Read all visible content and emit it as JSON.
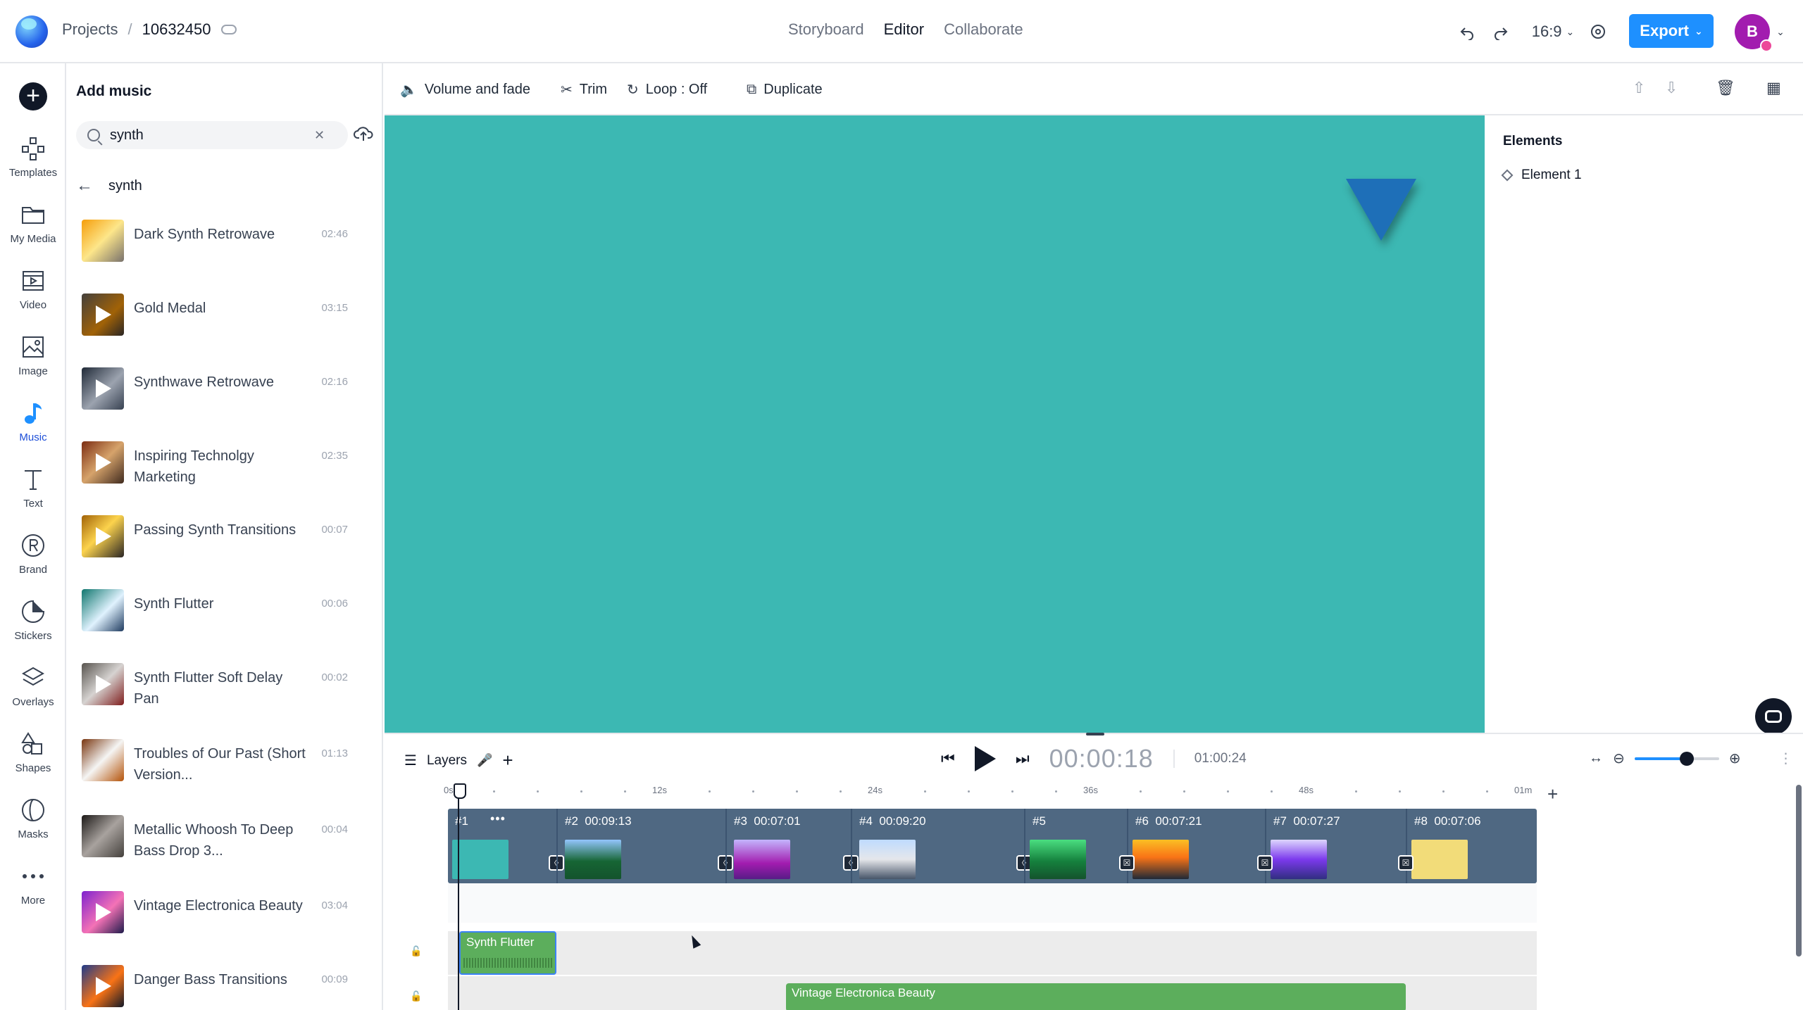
{
  "header": {
    "projects_label": "Projects",
    "separator": "/",
    "project_id": "10632450",
    "modes": [
      "Storyboard",
      "Editor",
      "Collaborate"
    ],
    "active_mode": "Editor",
    "aspect_ratio": "16:9",
    "export_label": "Export",
    "avatar_initial": "B"
  },
  "rail": {
    "items": [
      {
        "label": "Templates",
        "icon": "templates-icon"
      },
      {
        "label": "My Media",
        "icon": "folder-icon"
      },
      {
        "label": "Video",
        "icon": "video-icon"
      },
      {
        "label": "Image",
        "icon": "image-icon"
      },
      {
        "label": "Music",
        "icon": "music-icon"
      },
      {
        "label": "Text",
        "icon": "text-icon"
      },
      {
        "label": "Brand",
        "icon": "brand-icon"
      },
      {
        "label": "Stickers",
        "icon": "stickers-icon"
      },
      {
        "label": "Overlays",
        "icon": "overlays-icon"
      },
      {
        "label": "Shapes",
        "icon": "shapes-icon"
      },
      {
        "label": "Masks",
        "icon": "masks-icon"
      },
      {
        "label": "More",
        "icon": "more-icon"
      }
    ],
    "active": "Music"
  },
  "music_panel": {
    "title": "Add music",
    "search_value": "synth",
    "category": "synth",
    "tracks": [
      {
        "name": "Dark Synth Retrowave",
        "duration": "02:46"
      },
      {
        "name": "Gold Medal",
        "duration": "03:15"
      },
      {
        "name": "Synthwave Retrowave",
        "duration": "02:16"
      },
      {
        "name": "Inspiring Technolgy Marketing",
        "duration": "02:35"
      },
      {
        "name": "Passing Synth Transitions",
        "duration": "00:07"
      },
      {
        "name": "Synth Flutter",
        "duration": "00:06"
      },
      {
        "name": "Synth Flutter Soft Delay Pan",
        "duration": "00:02"
      },
      {
        "name": "Troubles of Our Past (Short Version...",
        "duration": "01:13"
      },
      {
        "name": "Metallic Whoosh To Deep Bass Drop 3...",
        "duration": "00:04"
      },
      {
        "name": "Vintage Electronica Beauty",
        "duration": "03:04"
      },
      {
        "name": "Danger Bass Transitions",
        "duration": "00:09"
      }
    ]
  },
  "toolbar": {
    "volume_label": "Volume and fade",
    "trim_label": "Trim",
    "loop_label": "Loop : Off",
    "duplicate_label": "Duplicate"
  },
  "elements_panel": {
    "title": "Elements",
    "items": [
      "Element 1"
    ]
  },
  "timeline": {
    "layers_label": "Layers",
    "current_time": "00:00:18",
    "total_time": "01:00:24",
    "zoom_level": 0.62,
    "ruler_marks": [
      "0s",
      "12s",
      "24s",
      "36s",
      "48s",
      "01m"
    ],
    "scenes": [
      {
        "label": "#1",
        "duration": ""
      },
      {
        "label": "#2",
        "duration": "00:09:13"
      },
      {
        "label": "#3",
        "duration": "00:07:01"
      },
      {
        "label": "#4",
        "duration": "00:09:20"
      },
      {
        "label": "#5",
        "duration": ""
      },
      {
        "label": "#6",
        "duration": "00:07:21"
      },
      {
        "label": "#7",
        "duration": "00:07:27"
      },
      {
        "label": "#8",
        "duration": "00:07:06"
      }
    ],
    "audio_clips": [
      "Synth Flutter",
      "Vintage Electronica Beauty"
    ]
  },
  "colors": {
    "accent": "#1e90ff",
    "canvas_bg": "#3cb8b3",
    "shape": "#1e6fb8",
    "audio_clip": "#5cae5c",
    "scene_strip": "#4f6882",
    "avatar": "#a21caf"
  }
}
